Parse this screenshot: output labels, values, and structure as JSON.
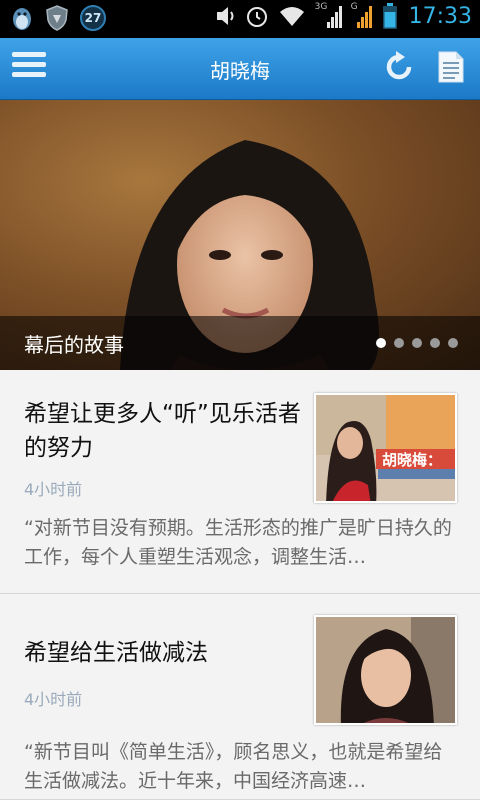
{
  "status_bar": {
    "notification_count": "27",
    "time": "17:33",
    "net_label_1": "3G",
    "net_label_2": "G"
  },
  "app_bar": {
    "title": "胡晓梅"
  },
  "hero": {
    "caption": "幕后的故事",
    "page_count": 5,
    "active_index": 0
  },
  "articles": [
    {
      "title": "希望让更多人“听”见乐活者的努力",
      "time": "4小时前",
      "summary": "“对新节目没有预期。生活形态的推广是旷日持久的工作，每个人重塑生活观念，调整生活…",
      "thumb_text": "胡晓梅："
    },
    {
      "title": "希望给生活做减法",
      "time": "4小时前",
      "summary": "“新节目叫《简单生活》，顾名思义，也就是希望给生活做减法。近十年来，中国经济高速…"
    }
  ],
  "colors": {
    "accent": "#35b5e5",
    "app_bar_top": "#3fa3e8",
    "app_bar_bottom": "#1b79c7",
    "time_text": "#9aaabb"
  }
}
